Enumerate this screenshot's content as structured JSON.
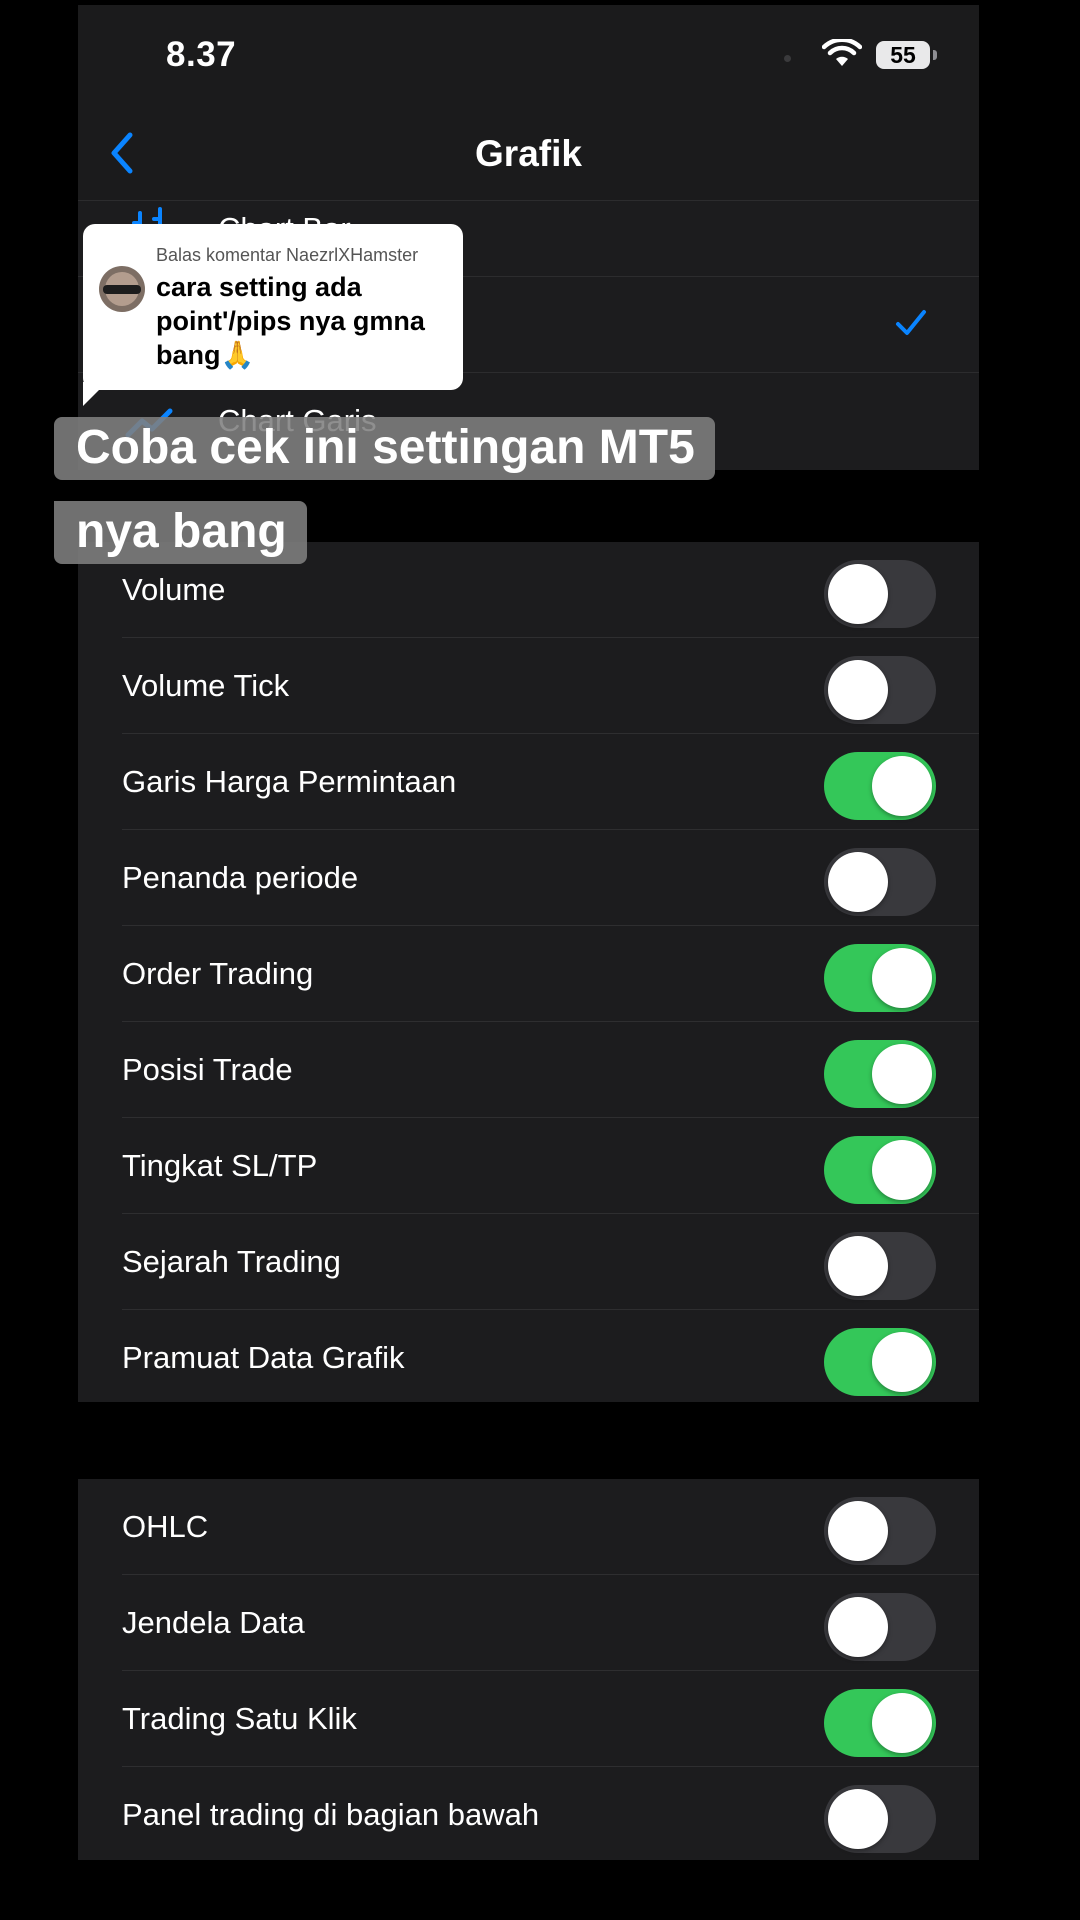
{
  "status": {
    "time": "8.37",
    "battery": "55"
  },
  "nav": {
    "back_icon": "chevron-left-icon",
    "title": "Grafik",
    "accent": "#0a84ff"
  },
  "chart_types": [
    {
      "label": "Chart Bar",
      "icon": "bar-chart-icon",
      "selected": false
    },
    {
      "label": "",
      "icon": "candlestick-icon",
      "selected": true
    },
    {
      "label": "Chart Garis",
      "icon": "line-chart-icon",
      "selected": false
    }
  ],
  "settings_group_1": [
    {
      "label": "Volume",
      "on": false
    },
    {
      "label": "Volume Tick",
      "on": false
    },
    {
      "label": "Garis Harga Permintaan",
      "on": true
    },
    {
      "label": "Penanda periode",
      "on": false
    },
    {
      "label": "Order Trading",
      "on": true
    },
    {
      "label": "Posisi Trade",
      "on": true
    },
    {
      "label": "Tingkat SL/TP",
      "on": true
    },
    {
      "label": "Sejarah Trading",
      "on": false
    },
    {
      "label": "Pramuat Data Grafik",
      "on": true
    }
  ],
  "settings_group_2": [
    {
      "label": "OHLC",
      "on": false
    },
    {
      "label": "Jendela Data",
      "on": false
    },
    {
      "label": "Trading Satu Klik",
      "on": true
    },
    {
      "label": "Panel trading di bagian bawah",
      "on": false
    }
  ],
  "colors": {
    "switch_on": "#34c759",
    "switch_off": "#39393d"
  },
  "comment": {
    "header": "Balas komentar NaezrlXHamster",
    "text": "cara setting ada point'/pips nya gmna bang🙏"
  },
  "caption": {
    "line1": "Coba cek ini settingan MT5",
    "line2": "nya bang"
  }
}
